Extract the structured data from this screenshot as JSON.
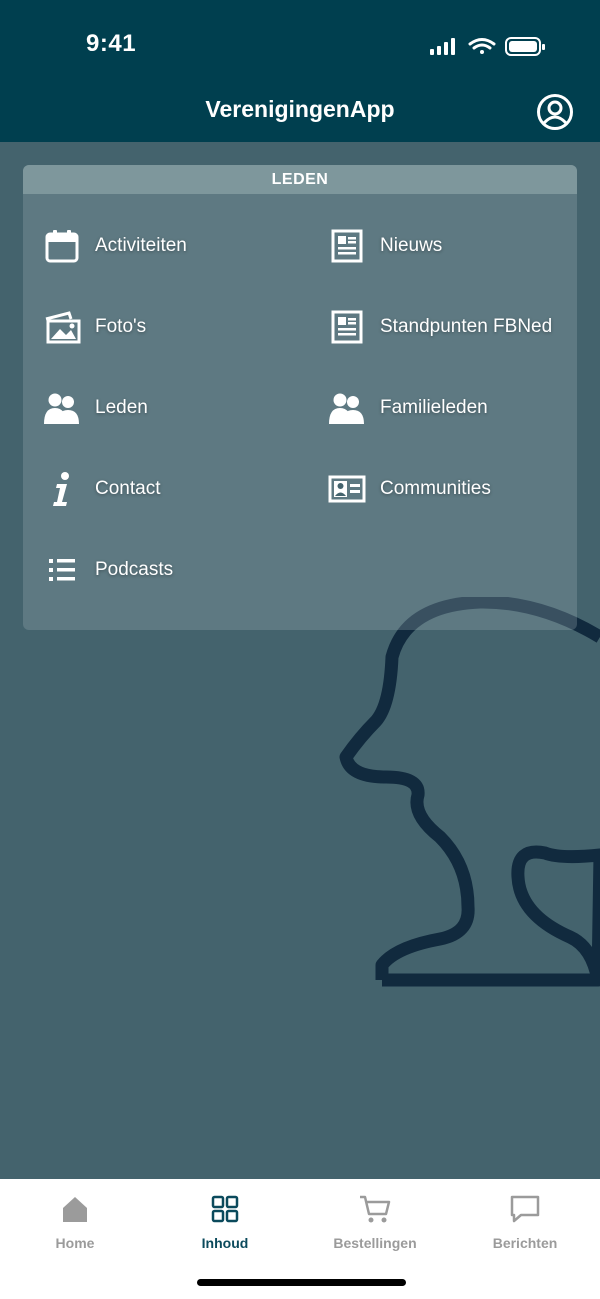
{
  "status_bar": {
    "time": "9:41"
  },
  "header": {
    "title": "VerenigingenApp",
    "profile_icon": "account-circle-icon"
  },
  "card": {
    "heading": "LEDEN",
    "items": [
      {
        "label": "Activiteiten",
        "icon": "calendar-icon"
      },
      {
        "label": "Nieuws",
        "icon": "newspaper-icon"
      },
      {
        "label": "Foto's",
        "icon": "photos-icon"
      },
      {
        "label": "Standpunten FBNed",
        "icon": "newspaper-icon"
      },
      {
        "label": "Leden",
        "icon": "users-icon"
      },
      {
        "label": "Familieleden",
        "icon": "users-icon"
      },
      {
        "label": "Contact",
        "icon": "info-icon"
      },
      {
        "label": "Communities",
        "icon": "id-card-icon"
      },
      {
        "label": "Podcasts",
        "icon": "list-icon"
      }
    ]
  },
  "tabbar": {
    "tabs": [
      {
        "label": "Home",
        "icon": "home-icon",
        "active": false
      },
      {
        "label": "Inhoud",
        "icon": "grid-icon",
        "active": true
      },
      {
        "label": "Bestellingen",
        "icon": "cart-icon",
        "active": false
      },
      {
        "label": "Berichten",
        "icon": "chat-icon",
        "active": false
      }
    ]
  },
  "colors": {
    "header_bg": "#003f4f",
    "background": "#44636d",
    "card_header_bg": "#7e979c",
    "active_tab": "#0b4a5c",
    "inactive_tab": "#9b9b9b",
    "silhouette_stroke": "#112a3e"
  }
}
